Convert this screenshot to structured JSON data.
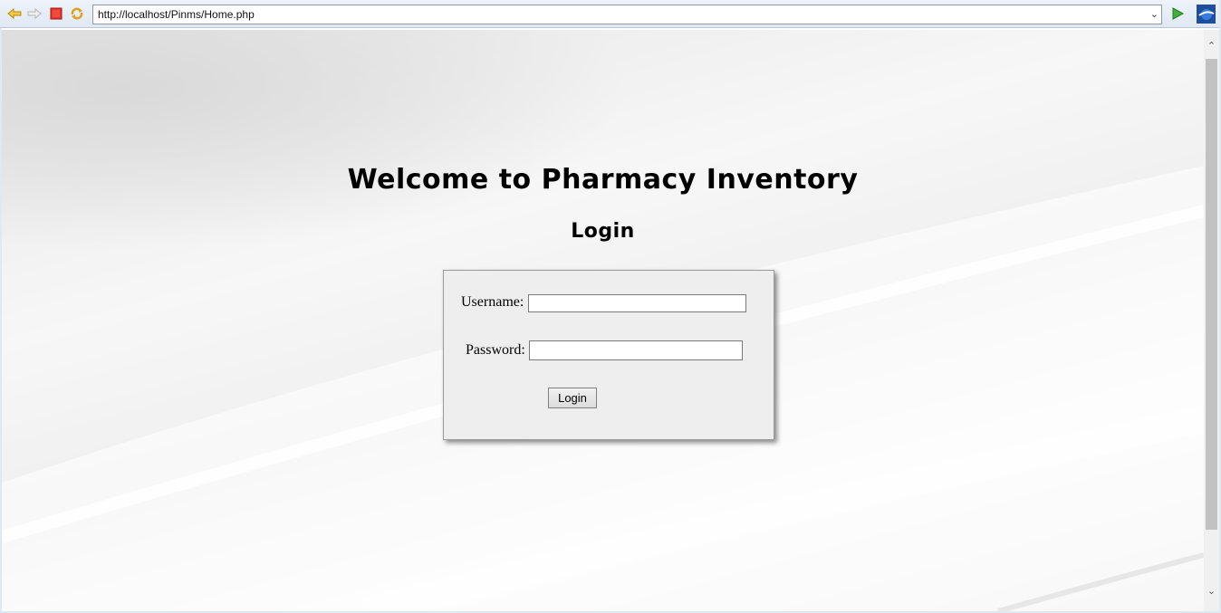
{
  "browser": {
    "url": "http://localhost/Pinms/Home.php",
    "icons": [
      "back-icon",
      "forward-icon",
      "stop-icon",
      "refresh-icon",
      "go-icon",
      "browser-logo-icon"
    ]
  },
  "page": {
    "welcome_title": "Welcome to Pharmacy Inventory",
    "login_heading": "Login",
    "form": {
      "username_label": "Username:",
      "username_value": "",
      "password_label": "Password:",
      "password_value": "",
      "submit_label": "Login"
    }
  }
}
